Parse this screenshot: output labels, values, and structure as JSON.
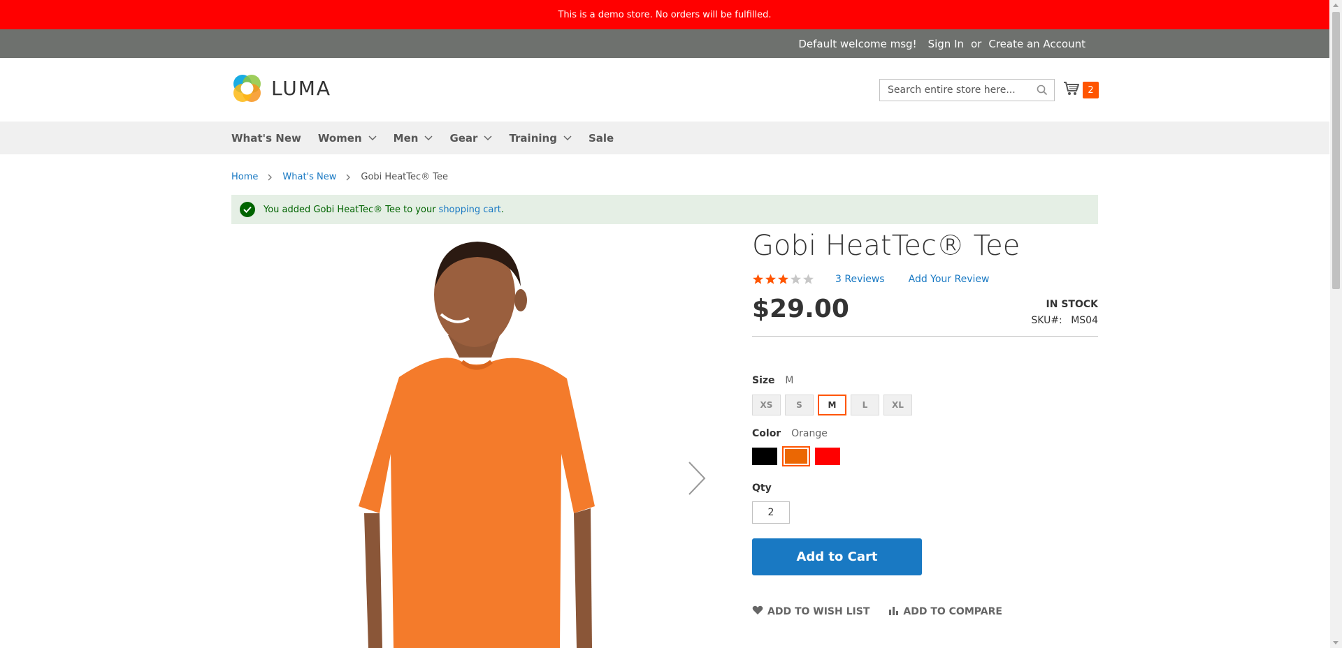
{
  "demo_notice": "This is a demo store. No orders will be fulfilled.",
  "panel": {
    "welcome": "Default welcome msg!",
    "sign_in": "Sign In",
    "or": "or",
    "create_account": "Create an Account"
  },
  "header": {
    "logo_text": "LUMA",
    "search_placeholder": "Search entire store here...",
    "cart_count": "2"
  },
  "nav": {
    "items": [
      {
        "label": "What's New"
      },
      {
        "label": "Women"
      },
      {
        "label": "Men"
      },
      {
        "label": "Gear"
      },
      {
        "label": "Training"
      },
      {
        "label": "Sale"
      }
    ]
  },
  "breadcrumb": {
    "home": "Home",
    "whats_new": "What's New",
    "current": "Gobi HeatTec® Tee"
  },
  "message": {
    "text": "You added Gobi HeatTec® Tee to your",
    "link": "shopping cart",
    "end": "."
  },
  "product": {
    "title": "Gobi HeatTec® Tee",
    "rating_fraction": 0.6,
    "reviews_link": "3  Reviews",
    "add_review": "Add Your Review",
    "price": "$29.00",
    "stock": "IN STOCK",
    "sku_label": "SKU#:",
    "sku": "MS04",
    "size_label": "Size",
    "size_selected": "M",
    "sizes": [
      "XS",
      "S",
      "M",
      "L",
      "XL"
    ],
    "color_label": "Color",
    "color_selected": "Orange",
    "colors": [
      "#000000",
      "#eb6703",
      "#ff0000"
    ],
    "qty_label": "Qty",
    "qty": "2",
    "add_to_cart": "Add to Cart",
    "wishlist": "Add to Wish List",
    "compare": "Add to Compare"
  },
  "colors": {
    "accent": "#ff5501",
    "link": "#1979c3",
    "demo_bar": "#ff0000"
  }
}
